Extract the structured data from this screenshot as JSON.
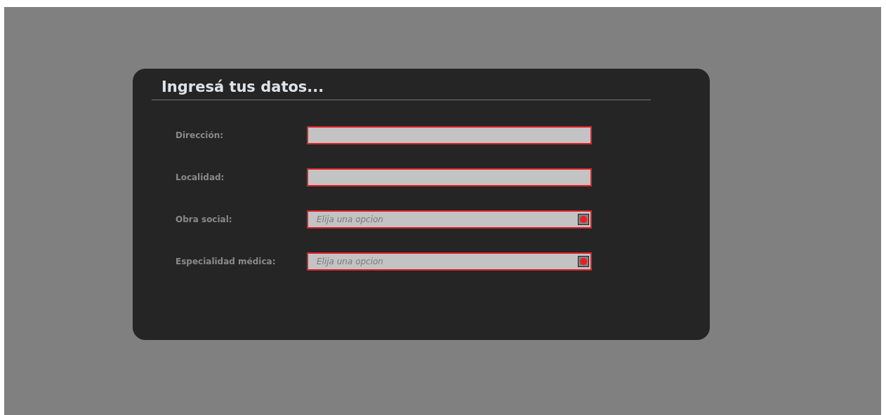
{
  "title": "Ingresá tus datos...",
  "fields": [
    {
      "label": "Dirección:",
      "kind": "text"
    },
    {
      "label": "Localidad:",
      "kind": "text"
    },
    {
      "label": "Obra social:",
      "kind": "select",
      "placeholder": "Elija una opcion"
    },
    {
      "label": "Especialidad médica:",
      "kind": "select",
      "placeholder": "Elija una opcion"
    }
  ]
}
